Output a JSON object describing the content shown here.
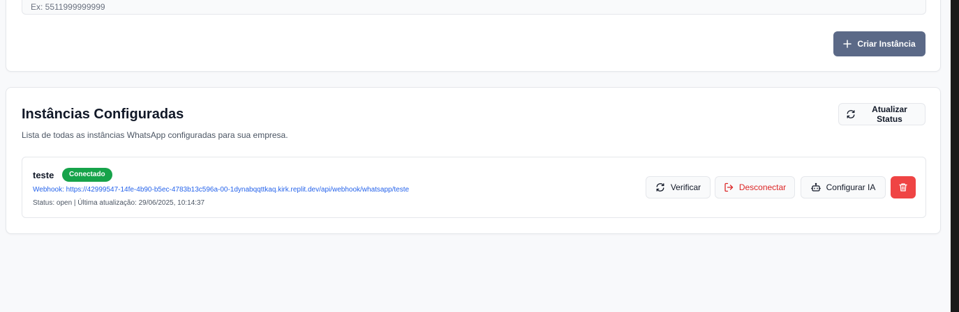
{
  "create_card": {
    "phone_placeholder": "Ex: 5511999999999",
    "create_button_label": "Criar Instância"
  },
  "instances_card": {
    "title": "Instâncias Configuradas",
    "description": "Lista de todas as instâncias WhatsApp configuradas para sua empresa.",
    "refresh_button_label": "Atualizar Status",
    "instances": [
      {
        "name": "teste",
        "status_badge": "Conectado",
        "webhook": "Webhook: https://42999547-14fe-4b90-b5ec-4783b13c596a-00-1dynabqqttkaq.kirk.replit.dev/api/webhook/whatsapp/teste",
        "status_line": "Status: open | Última atualização: 29/06/2025, 10:14:37",
        "verify_label": "Verificar",
        "disconnect_label": "Desconectar",
        "configure_ai_label": "Configurar IA"
      }
    ]
  },
  "colors": {
    "primary_button": "#5b6987",
    "connected_badge": "#16a34a",
    "danger": "#ef4444",
    "link": "#2563eb"
  },
  "icons": {
    "create": "plus-icon",
    "refresh": "refresh-icon",
    "verify": "refresh-icon",
    "disconnect": "logout-icon",
    "configure_ai": "bot-icon",
    "delete": "trash-icon"
  }
}
